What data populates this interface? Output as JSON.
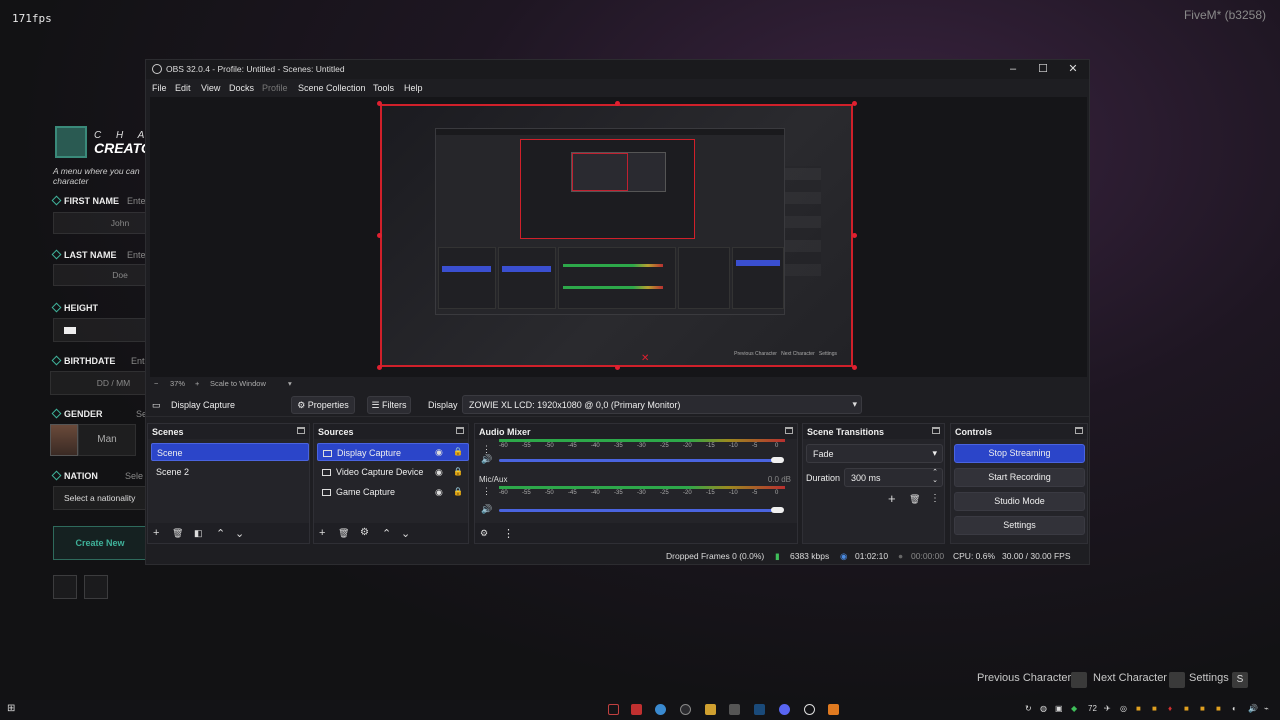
{
  "overlay": {
    "fps": "171fps",
    "fivem": "FiveM* (b3258)"
  },
  "character_creator": {
    "title_top": "C H A R",
    "title_bottom": "CREATO",
    "description": "A menu where you can character",
    "first_name_label": "FIRST NAME",
    "first_name_placeholder": "Ente",
    "first_name_value": "John",
    "last_name_label": "LAST NAME",
    "last_name_placeholder": "Ente",
    "last_name_value": "Doe",
    "height_label": "HEIGHT",
    "birthdate_label": "BIRTHDATE",
    "birthdate_placeholder": "Ent",
    "birthdate_value": "DD / MM",
    "gender_label": "GENDER",
    "gender_placeholder": "Se",
    "gender_value": "Man",
    "nation_label": "NATION",
    "nation_placeholder": "Sele",
    "nation_value": "Select a nationality",
    "create_label": "Create New"
  },
  "bottom_nav": {
    "previous": "Previous Character",
    "next": "Next Character",
    "settings": "Settings",
    "settings_key": "S"
  },
  "obs": {
    "title": "OBS 32.0.4 - Profile: Untitled - Scenes: Untitled",
    "menu": [
      "File",
      "Edit",
      "View",
      "Docks",
      "Profile",
      "Scene Collection",
      "Tools",
      "Help"
    ],
    "zoom": {
      "minus": "−",
      "percent": "37%",
      "plus": "+",
      "mode": "Scale to Window"
    },
    "source_bar": {
      "source": "Display Capture",
      "properties": "Properties",
      "filters": "Filters",
      "display_label": "Display",
      "display_value": "ZOWIE XL LCD: 1920x1080 @ 0,0 (Primary Monitor)"
    },
    "scenes": {
      "title": "Scenes",
      "items": [
        "Scene",
        "Scene 2"
      ]
    },
    "sources": {
      "title": "Sources",
      "items": [
        "Display Capture",
        "Video Capture Device",
        "Game Capture"
      ]
    },
    "audio_mixer": {
      "title": "Audio Mixer",
      "ticks": [
        "-60",
        "-55",
        "-50",
        "-45",
        "-40",
        "-35",
        "-30",
        "-25",
        "-20",
        "-15",
        "-10",
        "-5",
        "0"
      ],
      "channel2_name": "Mic/Aux",
      "channel2_db": "0.0 dB"
    },
    "transitions": {
      "title": "Scene Transitions",
      "type": "Fade",
      "duration_label": "Duration",
      "duration_value": "300 ms"
    },
    "controls": {
      "title": "Controls",
      "buttons": [
        "Stop Streaming",
        "Start Recording",
        "Studio Mode",
        "Settings"
      ]
    },
    "status": {
      "dropped": "Dropped Frames 0 (0.0%)",
      "kbps": "6383 kbps",
      "stream_time": "01:02:10",
      "rec_time": "00:00:00",
      "cpu": "CPU: 0.6%",
      "fps": "30.00 / 30.00 FPS"
    },
    "preview_caption": {
      "previous": "Previous Character",
      "next": "Next Character",
      "settings": "Settings"
    }
  },
  "taskbar": {
    "tray_number": "72"
  }
}
